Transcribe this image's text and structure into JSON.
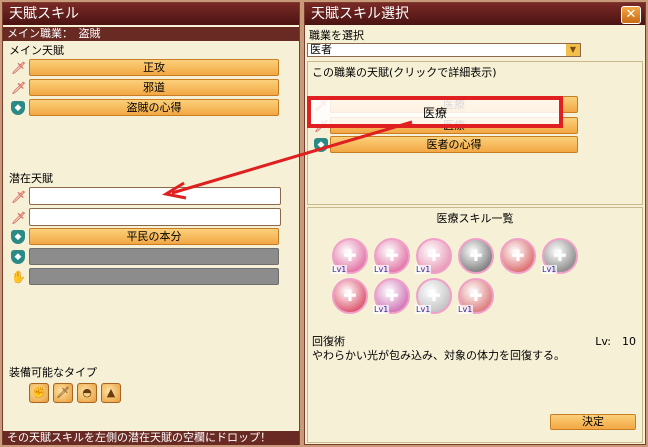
{
  "left": {
    "title": "天賦スキル",
    "job_bar": "メイン職業：　盗賊",
    "main_label": "メイン天賦",
    "main_slots": [
      "正攻",
      "邪道",
      "盗賊の心得"
    ],
    "latent_label": "潜在天賦",
    "latent_slots": [
      "",
      "",
      "平民の本分",
      "",
      ""
    ],
    "equip_label": "装備可能なタイプ",
    "footer": "その天賦スキルを左側の潜在天賦の空欄にドロップ！"
  },
  "right": {
    "title": "天賦スキル選択",
    "job_select_label": "職業を選択",
    "job_select_value": "医者",
    "talent_header": "この職業の天賦(クリックで詳細表示)",
    "talents": [
      "医療",
      "医療",
      "医者の心得"
    ],
    "skill_list_title": "医療スキル一覧",
    "skill_icons": [
      {
        "name": "heal-cross-icon",
        "lv": "Lv1",
        "color": "#d84a8a"
      },
      {
        "name": "heal-cross-2-icon",
        "lv": "Lv1",
        "color": "#d84a8a"
      },
      {
        "name": "heart-heal-icon",
        "lv": "Lv1",
        "color": "#e07aa0"
      },
      {
        "name": "skull-icon",
        "lv": "",
        "color": "#555555"
      },
      {
        "name": "antidote-icon",
        "lv": "",
        "color": "#d04040"
      },
      {
        "name": "syringe-icon",
        "lv": "Lv1",
        "color": "#666666"
      },
      {
        "name": "medkit-icon",
        "lv": "",
        "color": "#d02040"
      },
      {
        "name": "cure-icon",
        "lv": "Lv1",
        "color": "#c04aa0"
      },
      {
        "name": "revive-icon",
        "lv": "Lv1",
        "color": "#b0b0b0"
      },
      {
        "name": "bandage-icon",
        "lv": "Lv1",
        "color": "#d05050"
      }
    ],
    "skill_name": "回復術",
    "skill_level": "Lv:　10",
    "skill_desc": "やわらかい光が包み込み、対象の体力を回復する。",
    "confirm": "決定"
  },
  "colors": {
    "title_bar": "#5a1c18",
    "button_fill": "#f2a744",
    "annotation": "#e02020"
  }
}
